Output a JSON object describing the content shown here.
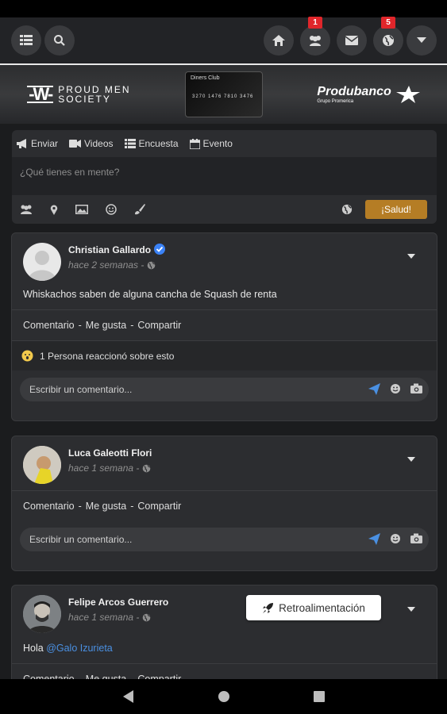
{
  "topbar": {
    "friends_badge": "1",
    "globe_badge": "5",
    "icons": [
      "menu-icon",
      "search-icon",
      "home-icon",
      "friends-icon",
      "mail-icon",
      "globe-icon",
      "caret-down-icon"
    ]
  },
  "banner": {
    "pms_logo": "-W-",
    "pms_line1": "PROUD MEN",
    "pms_line2": "SOCIETY",
    "card_brand": "Diners Club",
    "card_number": "3270 1476 7810 3476",
    "bank_name": "Produbanco",
    "bank_sub": "Grupo Promerica"
  },
  "composer": {
    "tabs": [
      "Enviar",
      "Videos",
      "Encuesta",
      "Evento"
    ],
    "placeholder": "¿Qué tienes en mente?",
    "submit_label": "¡Salud!"
  },
  "posts": [
    {
      "author": "Christian Gallardo",
      "time": "hace 2 semanas -",
      "verified": true,
      "text": "Whiskachos saben de alguna cancha de Squash de renta",
      "actions": [
        "Comentario",
        "Me gusta",
        "Compartir"
      ],
      "reactions": "1 Persona reaccionó sobre esto",
      "comment_placeholder": "Escribir un comentario..."
    },
    {
      "author": "Luca Galeotti Flori",
      "time": "hace 1 semana -",
      "text": "",
      "actions": [
        "Comentario",
        "Me gusta",
        "Compartir"
      ],
      "comment_placeholder": "Escribir un comentario..."
    },
    {
      "author": "Felipe Arcos Guerrero",
      "time": "hace 1 semana -",
      "text_prefix": "Hola ",
      "mention": "@Galo Izurieta",
      "actions": [
        "Comentario",
        "Me gusta",
        "Compartir"
      ]
    }
  ],
  "feedback_button": "Retroalimentación",
  "colors": {
    "accent": "#b57d25",
    "link": "#4a90e2",
    "badge": "#e0262b",
    "background": "#1b1c1e",
    "card": "#2c2d30"
  }
}
